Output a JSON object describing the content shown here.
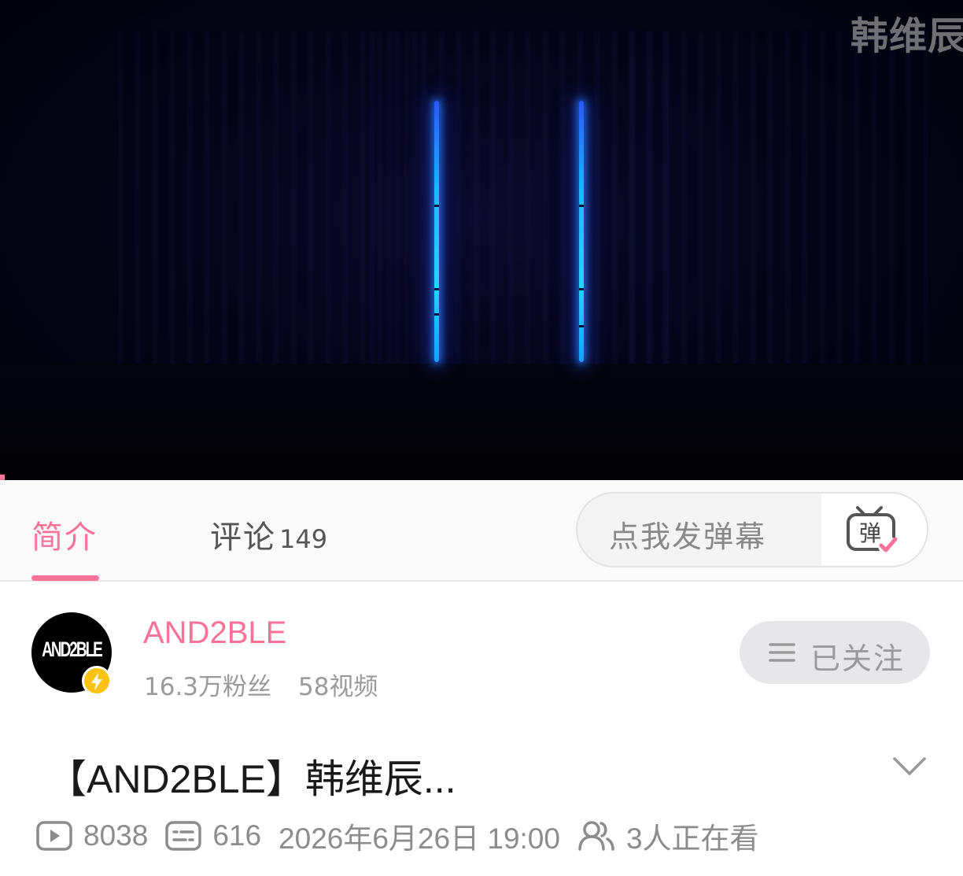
{
  "video": {
    "watermark": "韩维辰"
  },
  "tabs": {
    "intro_label": "简介",
    "comments_label": "评论",
    "comments_count": "149"
  },
  "danmaku": {
    "placeholder": "点我发弹幕",
    "toggle_icon_text": "弹",
    "toggle_icon": "danmaku-on-icon"
  },
  "uploader": {
    "avatar_text": "AND2BLE",
    "name": "AND2BLE",
    "followers": "16.3万粉丝",
    "videos": "58视频",
    "follow_label": "已关注",
    "badge_icon": "lightning-icon"
  },
  "title": {
    "text": "【AND2BLE】韩维辰..."
  },
  "meta": {
    "plays": "8038",
    "danmaku_count": "616",
    "datetime": "2026年6月26日 19:00",
    "watching": "3人正在看"
  },
  "colors": {
    "accent": "#fb7299",
    "badge": "#ffc20e"
  }
}
